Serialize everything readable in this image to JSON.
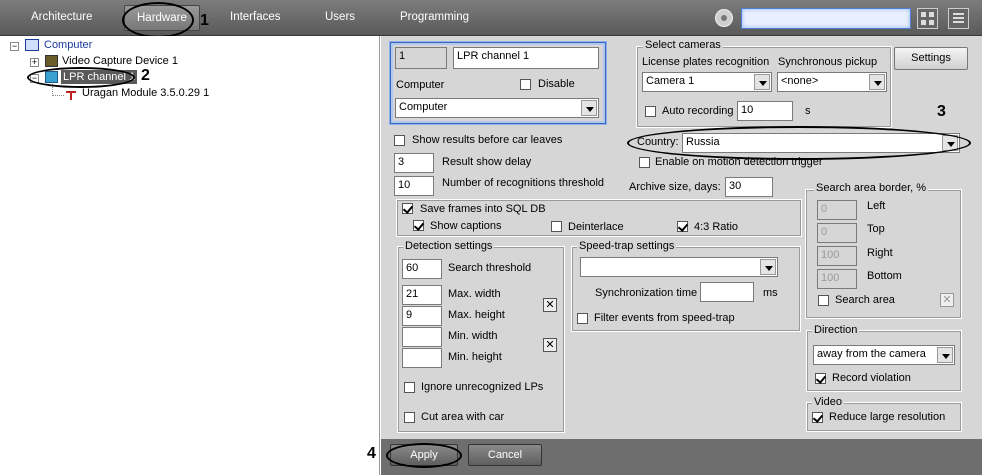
{
  "topbar": {
    "tabs": [
      "Architecture",
      "Hardware",
      "Interfaces",
      "Users",
      "Programming"
    ],
    "search_value": ""
  },
  "annotations": [
    "1",
    "2",
    "3",
    "4"
  ],
  "tree": {
    "root": "Computer",
    "device": "Video Capture Device 1",
    "channel": "LPR channel 1",
    "module": "Uragan Module 3.5.0.29 1"
  },
  "panel": {
    "id_value": "1",
    "name_value": "LPR channel 1",
    "computer_label": "Computer",
    "disable_label": "Disable",
    "computer_select": "Computer",
    "select_cameras": {
      "title": "Select cameras",
      "lpr_label": "License plates recognition",
      "sync_label": "Synchronous pickup",
      "camera_value": "Camera 1",
      "sync_value": "<none>",
      "auto_rec_label": "Auto recording",
      "auto_rec_value": "10",
      "sec_label": "s"
    },
    "settings_btn": "Settings",
    "country_label": "Country:",
    "country_value": "Russia",
    "motion_label": "Enable on motion detection trigger",
    "show_results_label": "Show results before car leaves",
    "delay_value": "3",
    "delay_label": "Result show delay",
    "recog_value": "10",
    "recog_label": "Number of recognitions threshold",
    "archive_label": "Archive size, days:",
    "archive_value": "30",
    "save_frames_label": "Save frames into SQL DB",
    "show_captions_label": "Show captions",
    "deinterlace_label": "Deinterlace",
    "ratio_label": "4:3 Ratio",
    "detection": {
      "title": "Detection settings",
      "search_threshold_value": "60",
      "search_threshold_label": "Search threshold",
      "max_width_value": "21",
      "max_width_label": "Max. width",
      "max_height_value": "9",
      "max_height_label": "Max. height",
      "min_width_value": "",
      "min_width_label": "Min. width",
      "min_height_value": "",
      "min_height_label": "Min. height",
      "ignore_label": "Ignore unrecognized LPs",
      "cut_label": "Cut area with car"
    },
    "speedtrap": {
      "title": "Speed-trap settings",
      "select_value": "",
      "sync_label": "Synchronization time",
      "sync_value": "",
      "ms_label": "ms",
      "filter_label": "Filter events from speed-trap"
    },
    "border": {
      "title": "Search area border, %",
      "left_value": "0",
      "left_label": "Left",
      "top_value": "0",
      "top_label": "Top",
      "right_value": "100",
      "right_label": "Right",
      "bottom_value": "100",
      "bottom_label": "Bottom",
      "search_area_label": "Search area"
    },
    "direction": {
      "title": "Direction",
      "value": "away from the camera",
      "record_label": "Record violation"
    },
    "video": {
      "title": "Video",
      "reduce_label": "Reduce large resolution"
    },
    "apply_btn": "Apply",
    "cancel_btn": "Cancel"
  }
}
